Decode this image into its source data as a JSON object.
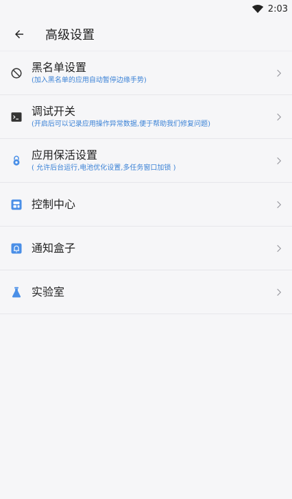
{
  "status_bar": {
    "time": "2:03"
  },
  "app_bar": {
    "title": "高级设置"
  },
  "items": [
    {
      "title": "黑名单设置",
      "subtitle": "(加入黑名单的应用自动暂停边缘手势)",
      "icon": "block-icon"
    },
    {
      "title": "调试开关",
      "subtitle": "(开启后可以记录应用操作异常数据,便于帮助我们修复问题)",
      "icon": "terminal-icon"
    },
    {
      "title": "应用保活设置",
      "subtitle": "( 允许后台运行,电池优化设置,多任务窗口加锁 )",
      "icon": "lock-icon"
    },
    {
      "title": "控制中心",
      "subtitle": "",
      "icon": "control-center-icon"
    },
    {
      "title": "通知盒子",
      "subtitle": "",
      "icon": "bell-icon"
    },
    {
      "title": "实验室",
      "subtitle": "",
      "icon": "flask-icon"
    }
  ],
  "colors": {
    "accent": "#3b82d6",
    "icon_blue": "#4a8fe7",
    "background": "#f6f6f8"
  }
}
